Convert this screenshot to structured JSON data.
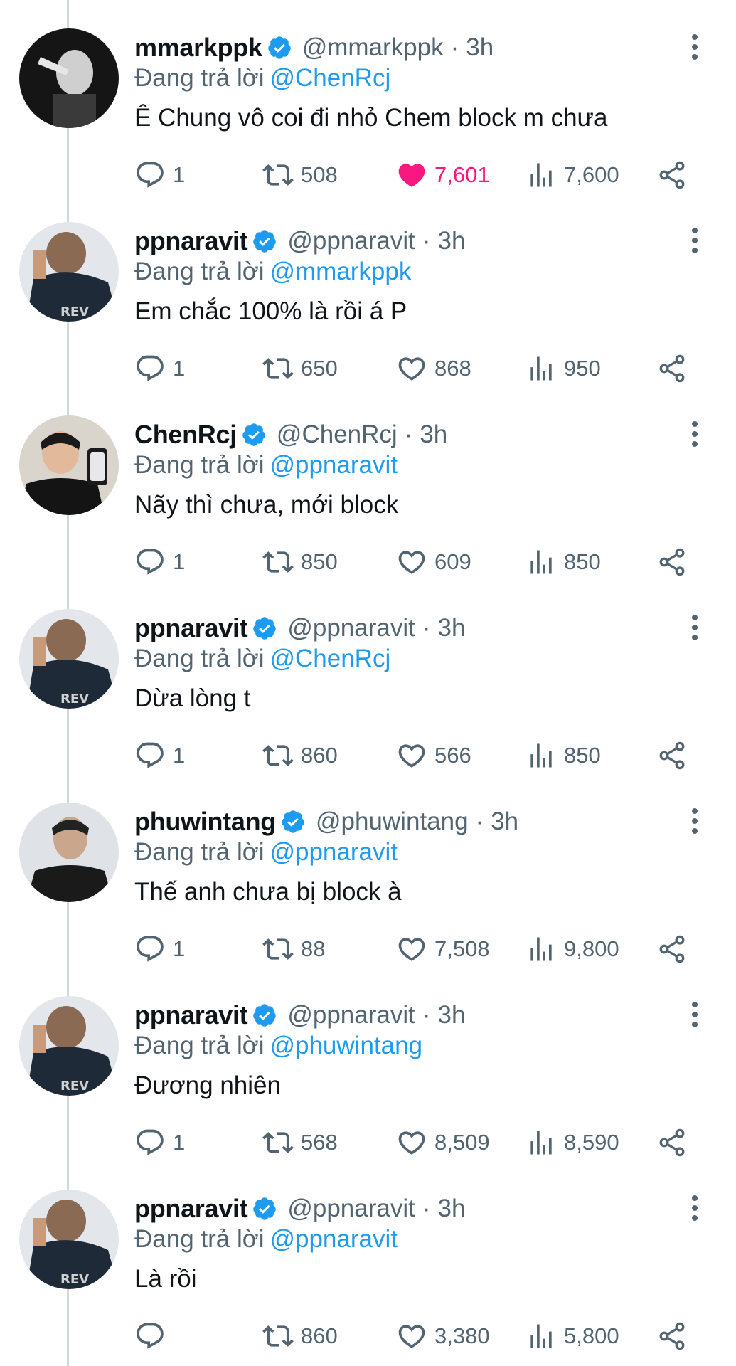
{
  "reply_prefix": "Đang trả lời",
  "colors": {
    "link": "#1d9bf0",
    "muted": "#536471",
    "like_active": "#f91880",
    "verified": "#1d9bf0"
  },
  "icons": {
    "reply": "reply-icon",
    "retweet": "retweet-icon",
    "like": "heart-icon",
    "views": "views-icon",
    "share": "share-icon",
    "more": "more-icon",
    "verified": "verified-badge-icon"
  },
  "tweets": [
    {
      "name": "mmarkppk",
      "handle": "@mmarkppk",
      "time": "3h",
      "reply_to": "@ChenRcj",
      "text": "Ê Chung vô coi đi nhỏ Chem block m chưa",
      "replies": "1",
      "retweets": "508",
      "likes": "7,601",
      "liked": true,
      "views": "7,600"
    },
    {
      "name": "ppnaravit",
      "handle": "@ppnaravit",
      "time": "3h",
      "reply_to": "@mmarkppk",
      "text": "Em chắc 100% là rồi á P",
      "replies": "1",
      "retweets": "650",
      "likes": "868",
      "liked": false,
      "views": "950"
    },
    {
      "name": "ChenRcj",
      "handle": "@ChenRcj",
      "time": "3h",
      "reply_to": "@ppnaravit",
      "text": "Nãy thì chưa, mới block",
      "replies": "1",
      "retweets": "850",
      "likes": "609",
      "liked": false,
      "views": "850"
    },
    {
      "name": "ppnaravit",
      "handle": "@ppnaravit",
      "time": "3h",
      "reply_to": "@ChenRcj",
      "text": "Dừa lòng t",
      "replies": "1",
      "retweets": "860",
      "likes": "566",
      "liked": false,
      "views": "850"
    },
    {
      "name": "phuwintang",
      "handle": "@phuwintang",
      "time": "3h",
      "reply_to": "@ppnaravit",
      "text": "Thế anh chưa bị block à",
      "replies": "1",
      "retweets": "88",
      "likes": "7,508",
      "liked": false,
      "views": "9,800"
    },
    {
      "name": "ppnaravit",
      "handle": "@ppnaravit",
      "time": "3h",
      "reply_to": "@phuwintang",
      "text": "Đương nhiên",
      "replies": "1",
      "retweets": "568",
      "likes": "8,509",
      "liked": false,
      "views": "8,590"
    },
    {
      "name": "ppnaravit",
      "handle": "@ppnaravit",
      "time": "3h",
      "reply_to": "@ppnaravit",
      "text": "Là rồi",
      "replies": "",
      "retweets": "860",
      "likes": "3,380",
      "liked": false,
      "views": "5,800"
    }
  ]
}
